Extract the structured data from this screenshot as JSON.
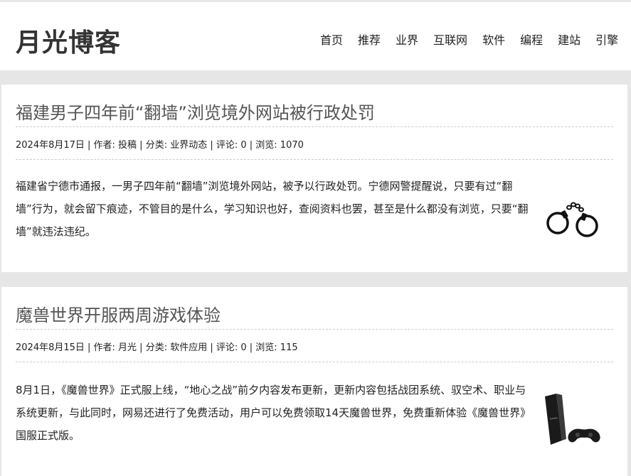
{
  "site": {
    "title": "月光博客"
  },
  "nav": [
    {
      "label": "首页"
    },
    {
      "label": "推荐"
    },
    {
      "label": "业界"
    },
    {
      "label": "互联网"
    },
    {
      "label": "软件"
    },
    {
      "label": "编程"
    },
    {
      "label": "建站"
    },
    {
      "label": "引擎"
    }
  ],
  "posts": [
    {
      "title": "福建男子四年前“翻墙”浏览境外网站被行政处罚",
      "meta": "2024年8月17日 | 作者: 投稿 | 分类: 业界动态 | 评论: 0 | 浏览: 1070",
      "excerpt": "福建省宁德市通报，一男子四年前“翻墙”浏览境外网站，被予以行政处罚。宁德网警提醒说，只要有过“翻墙”行为，就会留下痕迹，不管目的是什么，学习知识也好，查阅资料也罢，甚至是什么都没有浏览，只要“翻墙”就违法违纪。",
      "thumb_icon": "handcuffs-icon"
    },
    {
      "title": "魔兽世界开服两周游戏体验",
      "meta": "2024年8月15日 | 作者: 月光 | 分类: 软件应用 | 评论: 0 | 浏览: 115",
      "excerpt": "8月1日，《魔兽世界》正式服上线，“地心之战”前夕内容发布更新，更新内容包括战团系统、驭空术、职业与系统更新，与此同时，网易还进行了免费活动，用户可以免费领取14天魔兽世界，免费重新体验《魔兽世界》国服正式版。",
      "thumb_icon": "game-console-icon"
    }
  ]
}
